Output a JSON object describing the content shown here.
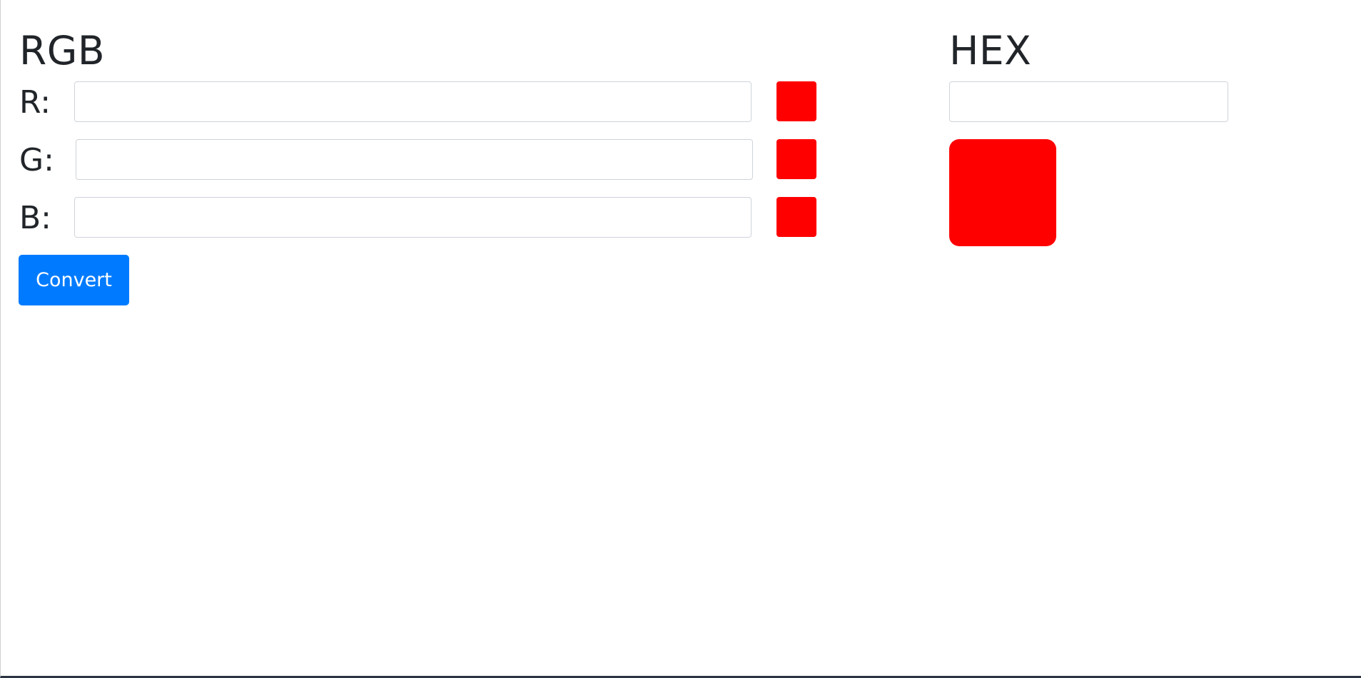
{
  "rgb": {
    "title": "RGB",
    "rows": [
      {
        "label": "R:",
        "value": "",
        "swatch_color": "#ff0000"
      },
      {
        "label": "G:",
        "value": "",
        "swatch_color": "#ff0000"
      },
      {
        "label": "B:",
        "value": "",
        "swatch_color": "#ff0000"
      }
    ],
    "convert_label": "Convert"
  },
  "hex": {
    "title": "HEX",
    "value": "",
    "preview_color": "#ff0000"
  },
  "colors": {
    "accent": "#007bff",
    "text": "#212529"
  }
}
